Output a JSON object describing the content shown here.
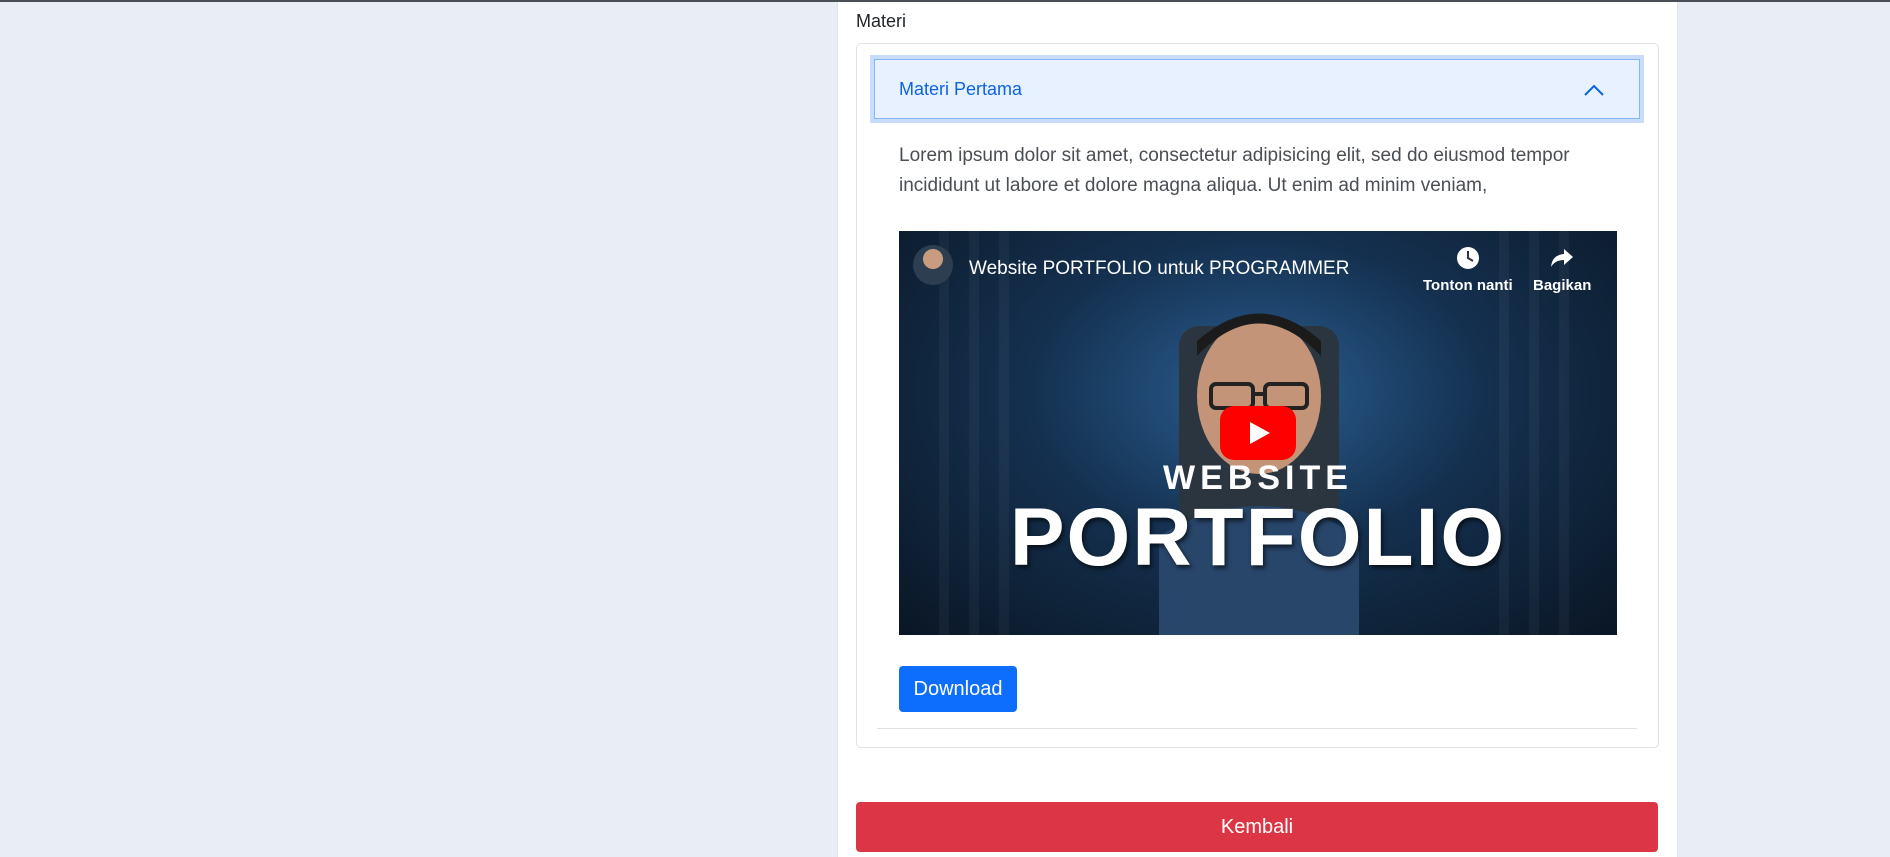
{
  "materi": {
    "section_label": "Materi",
    "accordion_title": "Materi Pertama",
    "description": "Lorem ipsum dolor sit amet, consectetur adipisicing elit, sed do eiusmod tempor incididunt ut labore et dolore magna aliqua. Ut enim ad minim veniam,",
    "video": {
      "title": "Website PORTFOLIO untuk PROGRAMMER",
      "watch_later_label": "Tonton nanti",
      "share_label": "Bagikan",
      "thumbnail_line1": "WEBSITE",
      "thumbnail_line2": "PORTFOLIO"
    },
    "download_label": "Download"
  },
  "back_label": "Kembali",
  "colors": {
    "primary": "#0d6efd",
    "danger": "#dc3545",
    "accordion_active_bg": "#e7f1ff",
    "accordion_active_text": "#0c63e4",
    "page_bg": "#e9eef6"
  },
  "icons": [
    "chevron-up-icon",
    "clock-icon",
    "share-icon",
    "play-icon"
  ]
}
